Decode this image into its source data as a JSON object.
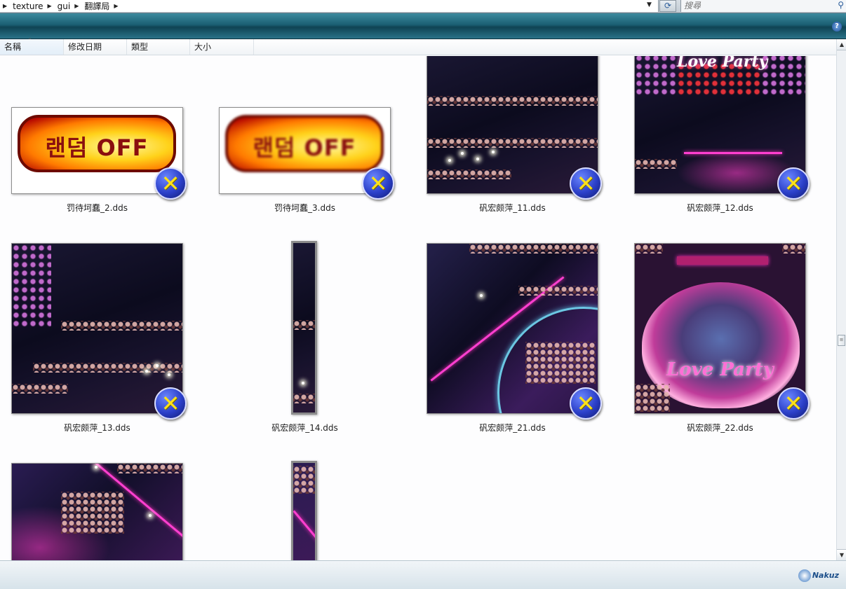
{
  "address_bar": {
    "crumbs": [
      "texture",
      "gui",
      "翻譯局"
    ],
    "search_placeholder": "搜尋"
  },
  "columns": [
    "名稱",
    "修改日期",
    "類型",
    "大小"
  ],
  "files": [
    {
      "name": "罚待坷蠢_2.dds"
    },
    {
      "name": "罚待坷蠢_3.dds"
    },
    {
      "name": "矾宏颇萍_11.dds"
    },
    {
      "name": "矾宏颇萍_12.dds"
    },
    {
      "name": "矾宏颇萍_13.dds"
    },
    {
      "name": "矾宏颇萍_14.dds"
    },
    {
      "name": "矾宏颇萍_21.dds"
    },
    {
      "name": "矾宏颇萍_22.dds"
    }
  ],
  "thumbnail_text": {
    "random_off": "랜덤 OFF",
    "love_party": "Love Party"
  },
  "icons": {
    "badge": "directx-x-icon",
    "help": "help-icon",
    "refresh": "refresh-icon",
    "search": "search-icon"
  },
  "badge_glyph": "✕",
  "help_glyph": "?",
  "watermark": "Nakuz",
  "colors": {
    "command_bar": "#1b5f73",
    "badge_blue": "#2b3fc8",
    "badge_x": "#ffe21a"
  }
}
